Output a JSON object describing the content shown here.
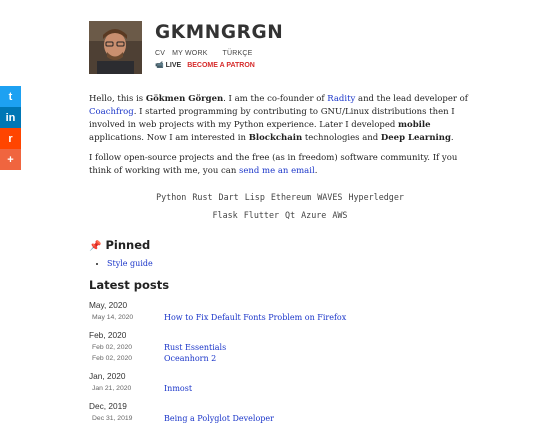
{
  "share": {
    "buttons": [
      {
        "icon": "twitter-icon",
        "glyph": "t",
        "color": "#1da1f2"
      },
      {
        "icon": "linkedin-icon",
        "glyph": "in",
        "color": "#0077b5"
      },
      {
        "icon": "reddit-icon",
        "glyph": "r",
        "color": "#ff4500"
      },
      {
        "icon": "plus-icon",
        "glyph": "+",
        "color": "#f0653f"
      }
    ]
  },
  "header": {
    "title": "GKMNGRGN",
    "nav": {
      "cv": "CV",
      "work": "MY WORK",
      "lang": "TÜRKÇE"
    },
    "live": "📹 LIVE",
    "patron": "BECOME A PATRON"
  },
  "intro": {
    "p1_a": "Hello, this is ",
    "name": "Gökmen Görgen",
    "p1_b": ". I am the co-founder of ",
    "rady": "Radity",
    "p1_c": " and the lead developer of ",
    "coach": "Coachfrog",
    "p1_d": ". I started programming by contributing to GNU/Linux distributions then I involved in web projects with my Python experience. Later I developed ",
    "mobile": "mobile",
    "p1_e": " applications. Now I am interested in ",
    "blockchain": "Blockchain",
    "p1_f": " technologies and ",
    "dl": "Deep Learning",
    "p1_g": ".",
    "p2_a": "I follow open-source projects and the free (as in freedom) software community. If you think of working with me, you can ",
    "email": "send me an email",
    "p2_b": "."
  },
  "tags_row1": [
    "Python",
    "Rust",
    "Dart",
    "Lisp",
    "Ethereum",
    "WAVES",
    "Hyperledger"
  ],
  "tags_row2": [
    "Flask",
    "Flutter",
    "Qt",
    "Azure",
    "AWS"
  ],
  "pinned": {
    "heading": "Pinned",
    "items": [
      "Style guide"
    ]
  },
  "latest": {
    "heading": "Latest posts",
    "groups": [
      {
        "month": "May, 2020",
        "posts": [
          {
            "date": "May 14, 2020",
            "title": "How to Fix Default Fonts Problem on Firefox"
          }
        ]
      },
      {
        "month": "Feb, 2020",
        "posts": [
          {
            "date": "Feb 02, 2020",
            "title": "Rust Essentials"
          },
          {
            "date": "Feb 02, 2020",
            "title": "Oceanhorn 2"
          }
        ]
      },
      {
        "month": "Jan, 2020",
        "posts": [
          {
            "date": "Jan 21, 2020",
            "title": "Inmost"
          }
        ]
      },
      {
        "month": "Dec, 2019",
        "posts": [
          {
            "date": "Dec 31, 2019",
            "title": "Being a Polyglot Developer"
          }
        ]
      }
    ]
  }
}
